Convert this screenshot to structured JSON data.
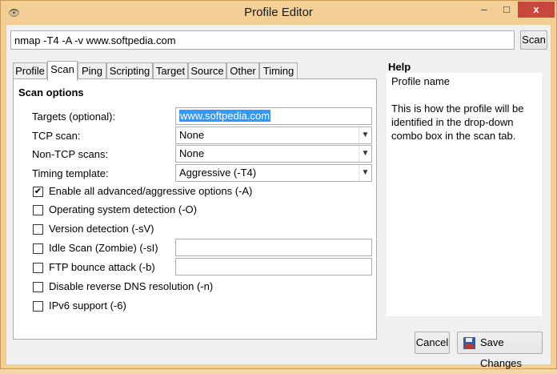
{
  "window": {
    "title": "Profile Editor",
    "close_glyph": "x",
    "min_glyph": "–",
    "max_glyph": "□"
  },
  "command": {
    "value": "nmap -T4 -A -v www.softpedia.com",
    "scan_label": "Scan"
  },
  "tabs": [
    {
      "label": "Profile"
    },
    {
      "label": "Scan"
    },
    {
      "label": "Ping"
    },
    {
      "label": "Scripting"
    },
    {
      "label": "Target"
    },
    {
      "label": "Source"
    },
    {
      "label": "Other"
    },
    {
      "label": "Timing"
    }
  ],
  "scan": {
    "section_title": "Scan options",
    "targets_label": "Targets (optional):",
    "targets_value": "www.softpedia.com",
    "tcp_label": "TCP scan:",
    "tcp_value": "None",
    "nontcp_label": "Non-TCP scans:",
    "nontcp_value": "None",
    "timing_label": "Timing template:",
    "timing_value": "Aggressive (-T4)",
    "options": [
      {
        "label": "Enable all advanced/aggressive options (-A)",
        "checked": true,
        "mark": "✔"
      },
      {
        "label": "Operating system detection (-O)",
        "checked": false,
        "mark": ""
      },
      {
        "label": "Version detection (-sV)",
        "checked": false,
        "mark": ""
      },
      {
        "label": "Idle Scan (Zombie) (-sI)",
        "checked": false,
        "mark": ""
      },
      {
        "label": "FTP bounce attack (-b)",
        "checked": false,
        "mark": ""
      },
      {
        "label": "Disable reverse DNS resolution (-n)",
        "checked": false,
        "mark": ""
      },
      {
        "label": "IPv6 support (-6)",
        "checked": false,
        "mark": ""
      }
    ]
  },
  "help": {
    "title": "Help",
    "heading": "Profile name",
    "text": "This is how the profile will be identified in the drop-down combo box in the scan tab."
  },
  "footer": {
    "cancel_label": "Cancel",
    "save_label": "Save Changes"
  }
}
